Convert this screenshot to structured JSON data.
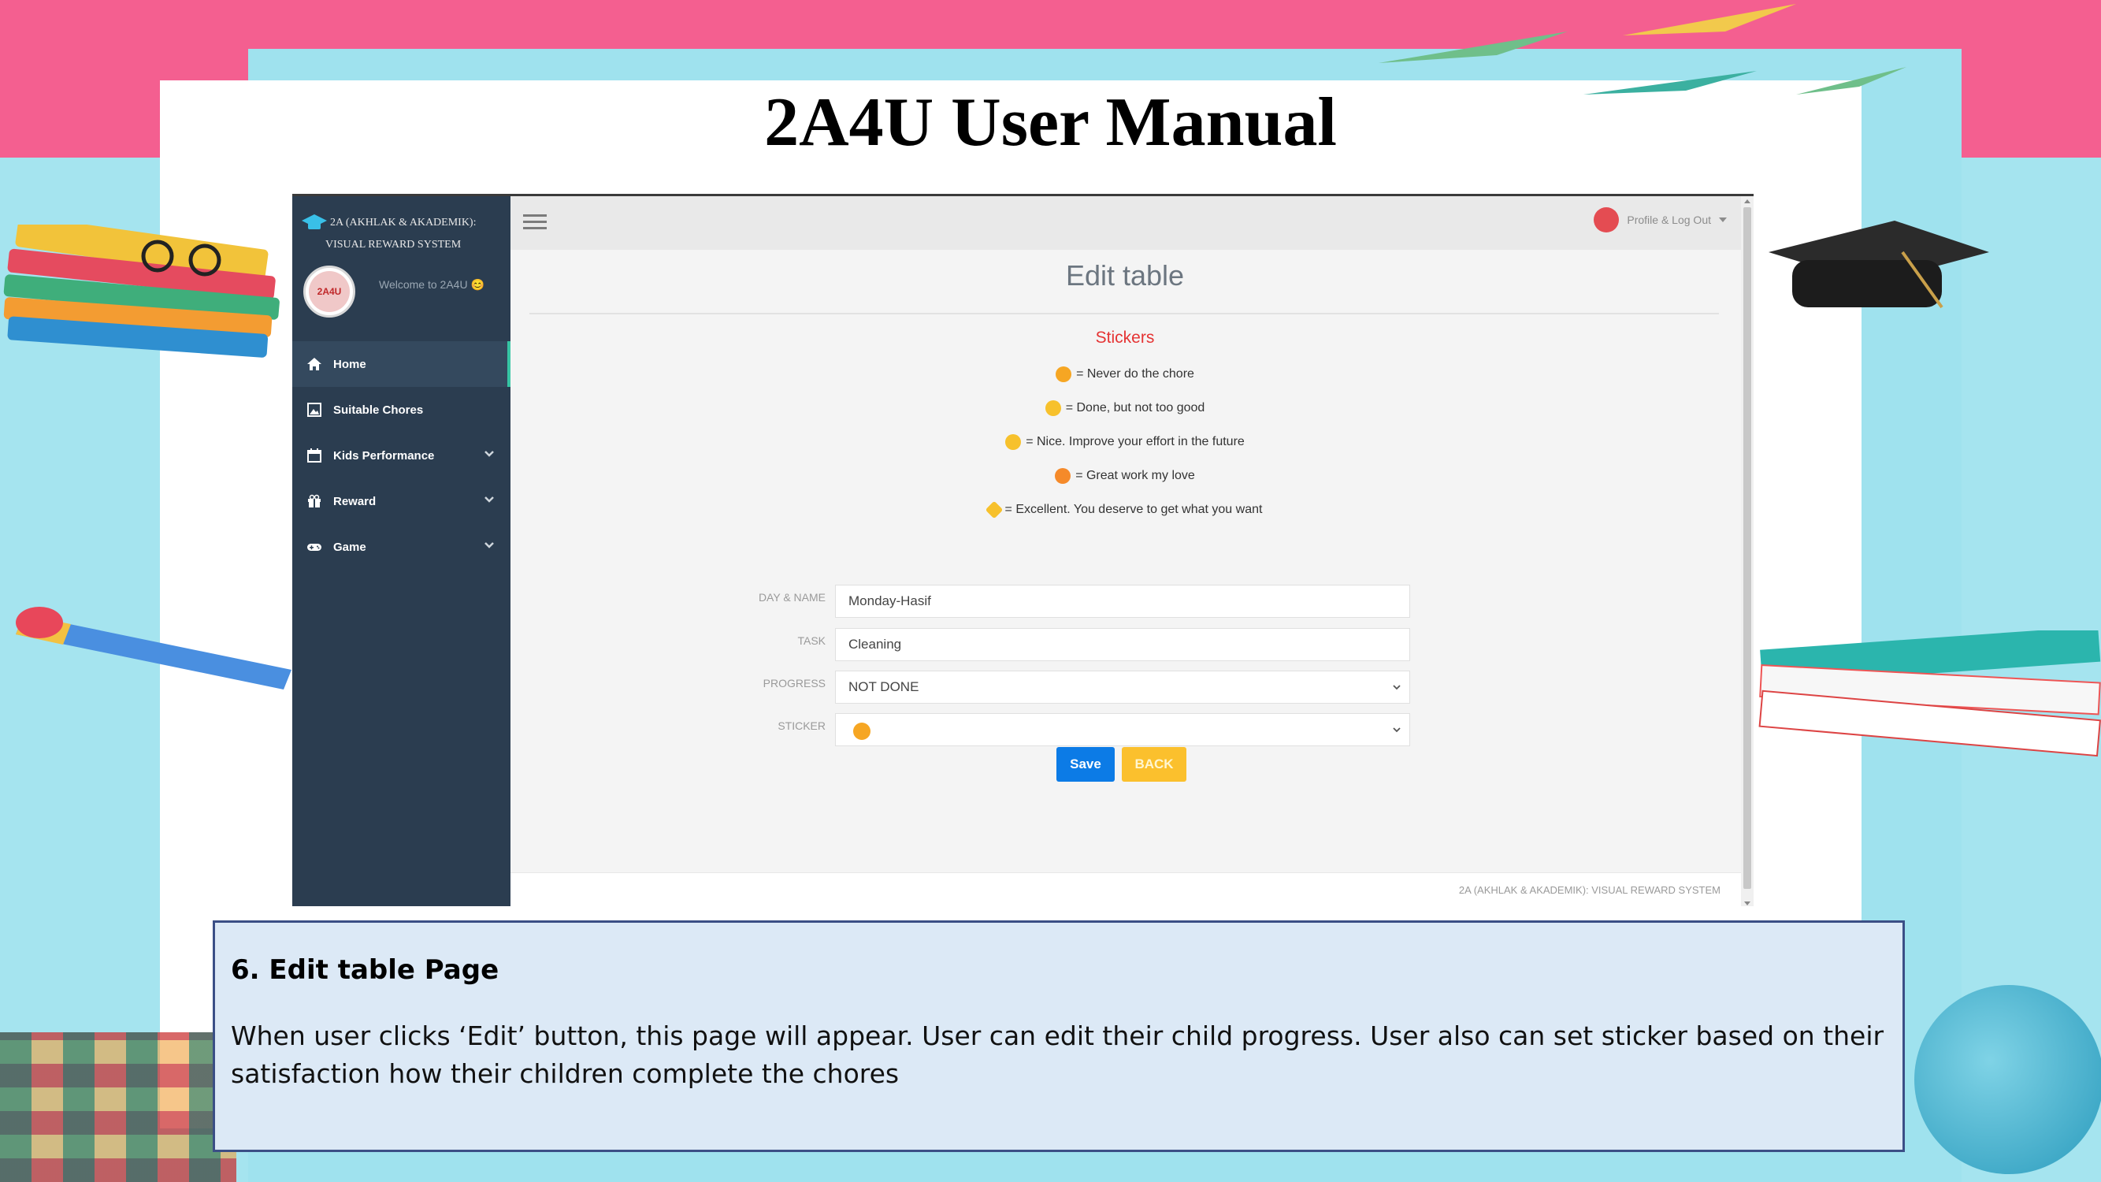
{
  "slide": {
    "title": "2A4U User Manual"
  },
  "app": {
    "brand_line1": "2A (AKHLAK & AKADEMIK):",
    "brand_line2": "VISUAL REWARD SYSTEM",
    "avatar_text": "2A4U",
    "welcome": "Welcome to 2A4U 😊",
    "nav": [
      {
        "label": "Home",
        "icon": "home-icon",
        "active": true
      },
      {
        "label": "Suitable Chores",
        "icon": "image-icon"
      },
      {
        "label": "Kids Performance",
        "icon": "calendar-icon",
        "has_dropdown": true
      },
      {
        "label": "Reward",
        "icon": "gift-icon",
        "has_dropdown": true
      },
      {
        "label": "Game",
        "icon": "gamepad-icon",
        "has_dropdown": true
      }
    ],
    "topbar": {
      "profile_label": "Profile & Log Out"
    },
    "page_title": "Edit table",
    "stickers": {
      "title": "Stickers",
      "legend": [
        {
          "emoji": "angry-face",
          "text": "= Never do the chore"
        },
        {
          "emoji": "neutral-face",
          "text": "= Done, but not too good"
        },
        {
          "emoji": "smile-face",
          "text": "= Nice. Improve your effort in the future"
        },
        {
          "emoji": "love-face",
          "text": "= Great work my love"
        },
        {
          "emoji": "star-badge",
          "text": "= Excellent. You deserve to get what you want"
        }
      ]
    },
    "form": {
      "day_name_label": "DAY & NAME",
      "day_name_value": "Monday-Hasif",
      "task_label": "TASK",
      "task_value": "Cleaning",
      "progress_label": "PROGRESS",
      "progress_value": "NOT DONE",
      "sticker_label": "STICKER",
      "sticker_value": "angry-face"
    },
    "buttons": {
      "save": "Save",
      "back": "BACK"
    },
    "footer": "2A (AKHLAK & AKADEMIK): VISUAL REWARD SYSTEM",
    "colors": {
      "sidebar": "#2b3d50",
      "save": "#0c7be6",
      "back": "#fbc02d",
      "stickers_title": "#e53333"
    }
  },
  "caption": {
    "heading": "6. Edit table Page",
    "body": "When user clicks ‘Edit’ button, this page will appear. User can edit their child progress. User also can set sticker based on their satisfaction  how their children complete the chores"
  }
}
